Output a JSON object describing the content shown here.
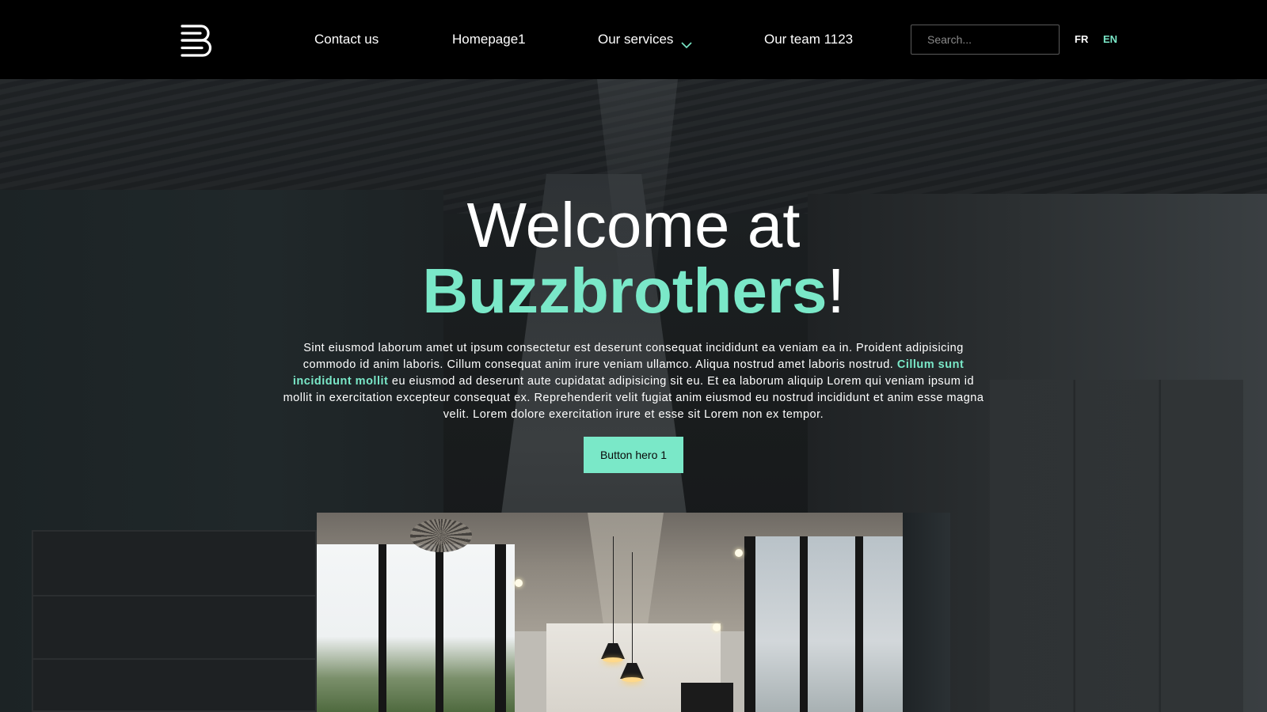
{
  "nav": {
    "links": [
      {
        "label": "Contact us"
      },
      {
        "label": "Homepage1"
      },
      {
        "label": "Our services"
      },
      {
        "label": "Our team 1123"
      }
    ],
    "search": {
      "placeholder": "Search...",
      "value": ""
    },
    "languages": [
      {
        "code": "FR",
        "active": false
      },
      {
        "code": "EN",
        "active": true
      }
    ],
    "icons": {
      "logo": "buzzbrothers-b-logo",
      "services_dropdown": "chevron-down-icon"
    }
  },
  "hero": {
    "title_line1": "Welcome at",
    "title_brand": "Buzzbrothers",
    "title_suffix": "!",
    "paragraph_before": "Sint eiusmod laborum amet ut ipsum consectetur est deserunt consequat incididunt ea veniam ea in. Proident adipisicing commodo id anim laboris. Cillum consequat anim irure veniam ullamco. Aliqua nostrud amet laboris nostrud. ",
    "paragraph_highlight": "Cillum sunt incididunt mollit",
    "paragraph_after": " eu eiusmod ad deserunt aute cupidatat adipisicing sit eu. Et ea laborum aliquip Lorem qui veniam ipsum id mollit in exercitation excepteur consequat ex. Reprehenderit velit fugiat anim eiusmod eu nostrud incididunt et anim esse magna velit. Lorem dolore exercitation irure et esse sit Lorem non ex tempor.",
    "button_label": "Button hero 1"
  },
  "colors": {
    "accent": "#7ae8c8",
    "navbar_bg": "#000000",
    "text": "#ffffff"
  }
}
